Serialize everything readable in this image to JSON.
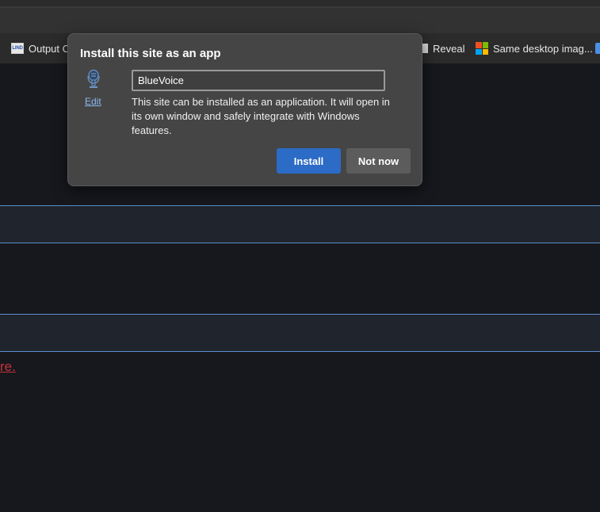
{
  "bookmarks": {
    "items": [
      {
        "label": "Output C",
        "icon": "lind-favicon"
      },
      {
        "label": "Reveal",
        "icon": "reveal-favicon"
      },
      {
        "label": "Same desktop imag...",
        "icon": "microsoft-logo-icon"
      }
    ],
    "lind_text": "LIND",
    "ms_colors": [
      "#f25022",
      "#7fba00",
      "#00a4ef",
      "#ffb900"
    ]
  },
  "page": {
    "red_link_text": "re."
  },
  "dialog": {
    "title": "Install this site as an app",
    "app_icon": "app-icon",
    "edit_label": "Edit",
    "app_name_value": "BlueVoice",
    "description": "This site can be installed as an application. It will open in its own window and safely integrate with Windows features.",
    "install_label": "Install",
    "not_now_label": "Not now"
  },
  "colors": {
    "accent": "#2c6bc6",
    "dialog_bg": "#454545",
    "page_bg": "#16181d",
    "band_border": "#5b8fd1",
    "link_red": "#c8303c"
  }
}
